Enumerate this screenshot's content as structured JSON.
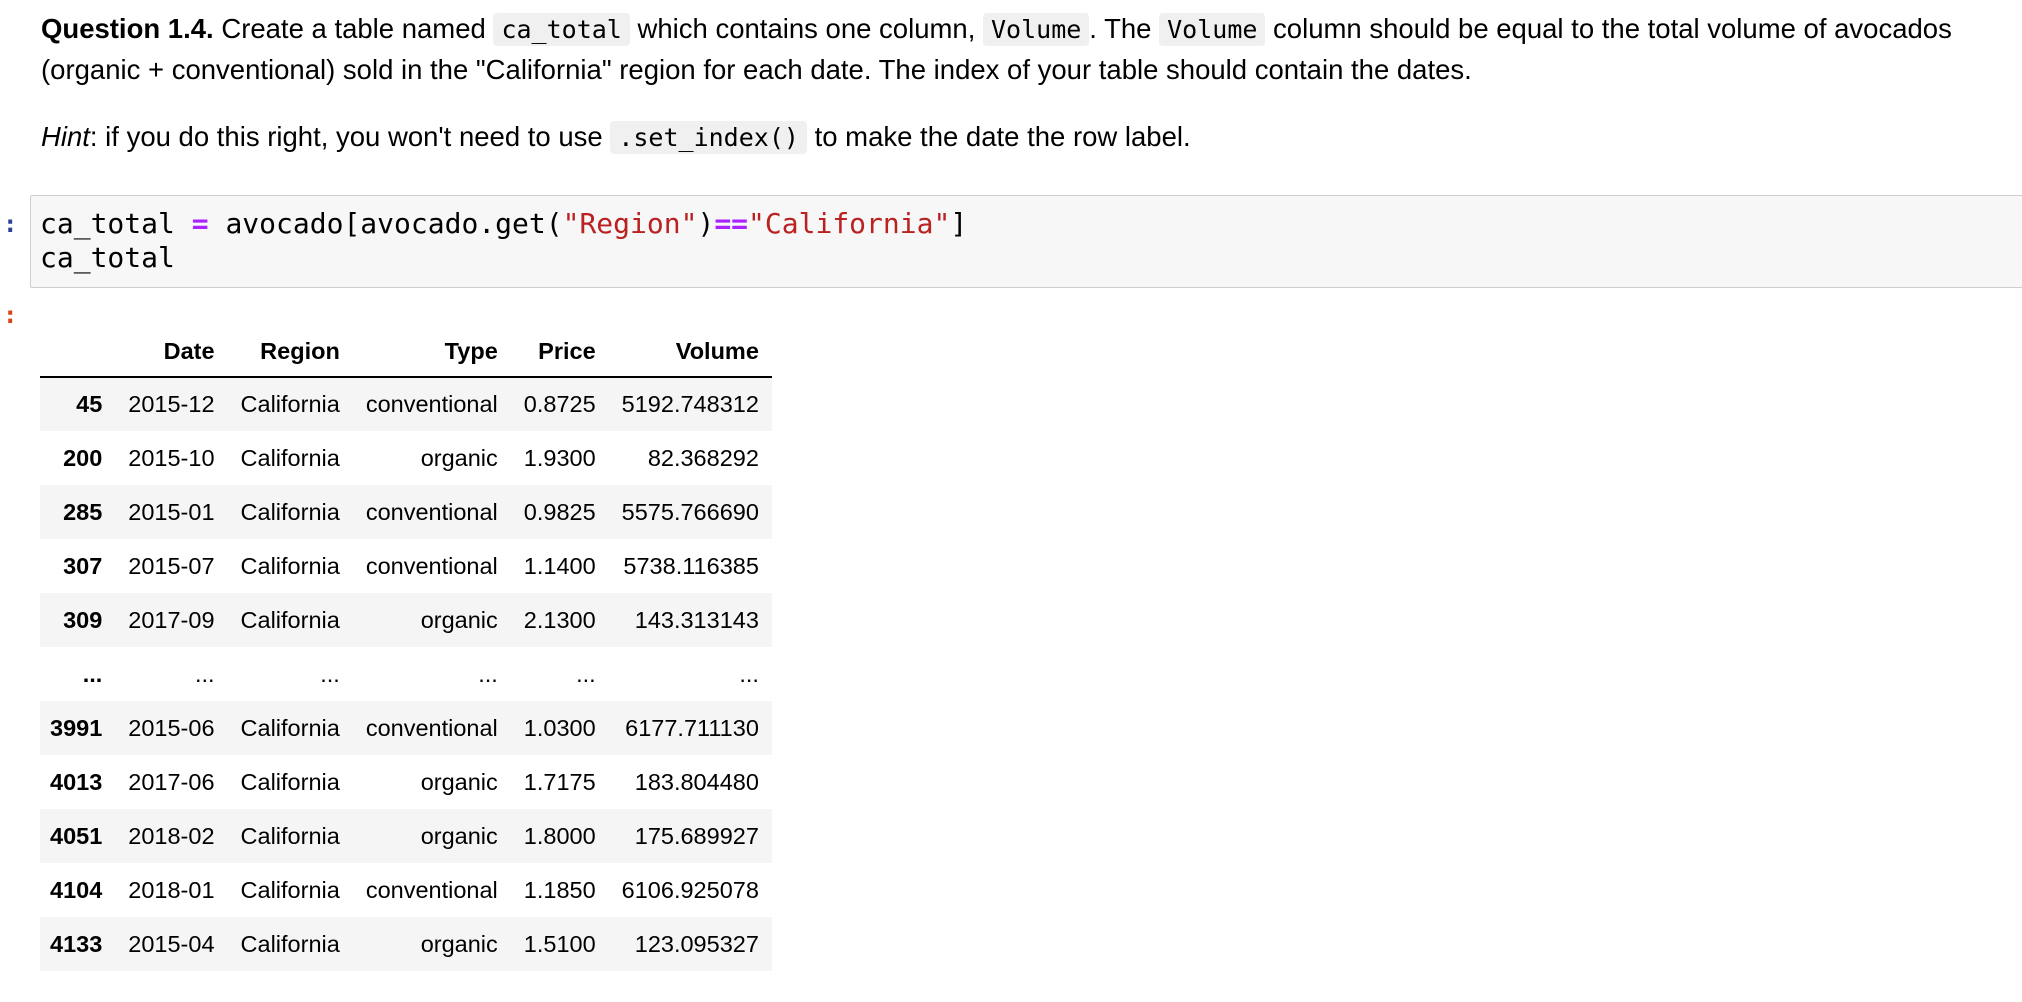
{
  "question": {
    "label": "Question 1.4.",
    "t1": " Create a table named ",
    "c1": "ca_total",
    "t2": " which contains one column, ",
    "c2": "Volume",
    "t3": ". The ",
    "c3": "Volume",
    "t4": " column should be equal to the total volume of avocados (organic + conventional) sold in the \"California\" region for each date. The index of your table should contain the dates."
  },
  "hint": {
    "label": "Hint",
    "t1": ": if you do this right, you won't need to use ",
    "code": ".set_index()",
    "t2": " to make the date the row label."
  },
  "prompts": {
    "input": ":",
    "output": ":"
  },
  "code": {
    "line1": {
      "var": "ca_total",
      "assign": "=",
      "obj": "avocado[avocado.get(",
      "str1": "\"Region\"",
      "close": ")",
      "eq": "==",
      "str2": "\"California\"",
      "end": "]"
    },
    "line2": "ca_total"
  },
  "table": {
    "columns": [
      "",
      "Date",
      "Region",
      "Type",
      "Price",
      "Volume"
    ],
    "rows": [
      {
        "idx": "45",
        "date": "2015-12",
        "region": "California",
        "type": "conventional",
        "price": "0.8725",
        "volume": "5192.748312"
      },
      {
        "idx": "200",
        "date": "2015-10",
        "region": "California",
        "type": "organic",
        "price": "1.9300",
        "volume": "82.368292"
      },
      {
        "idx": "285",
        "date": "2015-01",
        "region": "California",
        "type": "conventional",
        "price": "0.9825",
        "volume": "5575.766690"
      },
      {
        "idx": "307",
        "date": "2015-07",
        "region": "California",
        "type": "conventional",
        "price": "1.1400",
        "volume": "5738.116385"
      },
      {
        "idx": "309",
        "date": "2017-09",
        "region": "California",
        "type": "organic",
        "price": "2.1300",
        "volume": "143.313143"
      },
      {
        "idx": "...",
        "date": "...",
        "region": "...",
        "type": "...",
        "price": "...",
        "volume": "..."
      },
      {
        "idx": "3991",
        "date": "2015-06",
        "region": "California",
        "type": "conventional",
        "price": "1.0300",
        "volume": "6177.711130"
      },
      {
        "idx": "4013",
        "date": "2017-06",
        "region": "California",
        "type": "organic",
        "price": "1.7175",
        "volume": "183.804480"
      },
      {
        "idx": "4051",
        "date": "2018-02",
        "region": "California",
        "type": "organic",
        "price": "1.8000",
        "volume": "175.689927"
      },
      {
        "idx": "4104",
        "date": "2018-01",
        "region": "California",
        "type": "conventional",
        "price": "1.1850",
        "volume": "6106.925078"
      },
      {
        "idx": "4133",
        "date": "2015-04",
        "region": "California",
        "type": "organic",
        "price": "1.5100",
        "volume": "123.095327"
      }
    ]
  }
}
